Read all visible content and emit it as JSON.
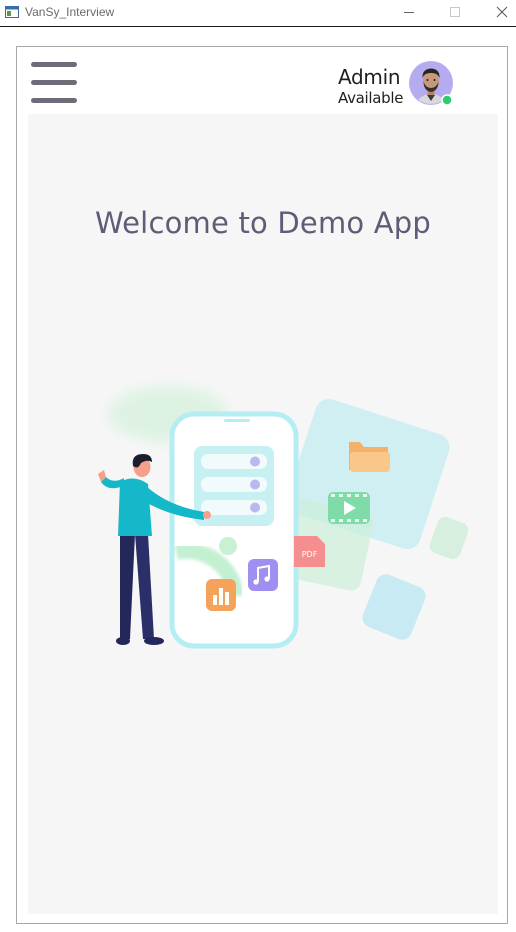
{
  "window": {
    "title": "VanSy_Interview",
    "icons": {
      "app": "app-window-icon",
      "minimize": "minimize-icon",
      "maximize": "maximize-icon",
      "close": "close-icon"
    }
  },
  "header": {
    "menu_icon": "hamburger-menu-icon",
    "user": {
      "name": "Admin",
      "status": "Available",
      "status_color": "#2ecc71"
    }
  },
  "main": {
    "welcome_text": "Welcome to Demo App",
    "background_color": "#f6f6f6",
    "illustration": {
      "icons": [
        "person-presenting-icon",
        "phone-icon",
        "folder-icon",
        "video-icon",
        "pdf-icon",
        "music-file-icon",
        "chart-file-icon"
      ],
      "pdf_label": "PDF"
    }
  },
  "colors": {
    "accent": "#5f5d76",
    "menu": "#6f6c7a",
    "cyan": "#a8e6ee",
    "green": "#8fdcb0",
    "orange": "#f5a35a",
    "purple": "#9f8ff0"
  }
}
